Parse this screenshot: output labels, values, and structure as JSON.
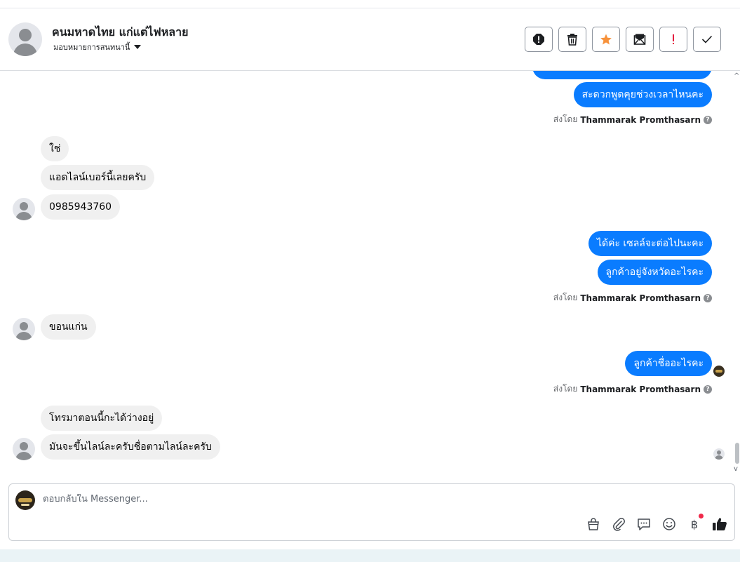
{
  "header": {
    "contact_name": "คนมหาดไทย แก่แต่ไฟหลาย",
    "assign_label": "มอบหมายการสนทนานี้"
  },
  "actions": [
    "spam-icon",
    "trash-icon",
    "star-icon",
    "unread-icon",
    "important-icon",
    "check-icon"
  ],
  "colors": {
    "outgoing": "#0a7cff",
    "incoming": "#f0f0f0",
    "star": "#f7923b",
    "important": "#e41e3f"
  },
  "thread": {
    "out_top_1": "สะดวกพูดคุยช่วงเวลาไหนคะ",
    "sent_by_label": "ส่งโดย",
    "sender_name": "Thammarak Promthasarn",
    "in_1": "ใช่",
    "in_2": "แอดไลน์เบอร์นี้เลยครับ",
    "in_3": "0985943760",
    "out_2": "ได้ค่ะ เซลล์จะต่อไปนะคะ",
    "out_3": "ลูกค้าอยู่จังหวัดอะไรคะ",
    "in_4": "ขอนแก่น",
    "out_4": "ลูกค้าชื่ออะไรคะ",
    "in_5": "โทรมาตอนนี้กะได้ว่างอยู่",
    "in_6": "มันจะขึ้นไลน์ละครับชื่อตามไลน์ละครับ"
  },
  "composer": {
    "placeholder": "ตอบกลับใน Messenger...",
    "tools": [
      "bag-icon",
      "attachment-icon",
      "saved-reply-icon",
      "emoji-icon",
      "baht-icon",
      "like-icon"
    ],
    "baht_symbol": "฿"
  }
}
